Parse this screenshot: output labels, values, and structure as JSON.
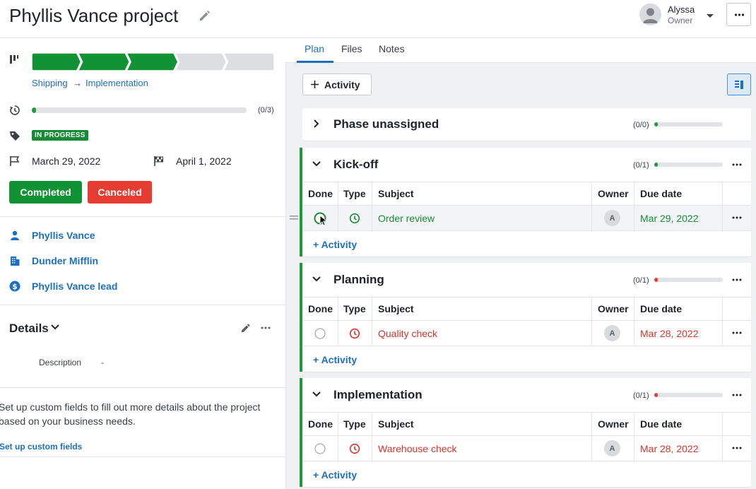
{
  "header": {
    "title": "Phyllis Vance project",
    "user_name": "Alyssa",
    "user_role": "Owner"
  },
  "left": {
    "pipeline": {
      "stages_total": 5,
      "stages_done": 3
    },
    "breadcrumb": {
      "from": "Shipping",
      "arrow": "→",
      "to": "Implementation"
    },
    "progress": {
      "count": "(0/3)",
      "fraction": 0.02
    },
    "status": "IN PROGRESS",
    "start_date": "March 29, 2022",
    "end_date": "April 1, 2022",
    "completed_label": "Completed",
    "canceled_label": "Canceled",
    "links": {
      "person": "Phyllis Vance",
      "org": "Dunder Mifflin",
      "lead": "Phyllis Vance lead"
    },
    "details": {
      "title": "Details",
      "description_label": "Description",
      "description_value": "-",
      "custom_text": "Set up custom fields to fill out more details about the project based on your business needs.",
      "custom_link": "Set up custom fields"
    }
  },
  "tabs": [
    "Plan",
    "Files",
    "Notes"
  ],
  "add_activity_label": "Activity",
  "columns": {
    "done": "Done",
    "type": "Type",
    "subject": "Subject",
    "owner": "Owner",
    "due": "Due date"
  },
  "phases": [
    {
      "title": "Phase unassigned",
      "count": "(0/0)",
      "fill_color": "#1a9c3e"
    },
    {
      "title": "Kick-off",
      "count": "(0/1)",
      "fill_color": "#1a9c3e",
      "activity": {
        "subject": "Order review",
        "owner": "A",
        "due": "Mar 29, 2022",
        "status": "green"
      },
      "add_label": "Activity"
    },
    {
      "title": "Planning",
      "count": "(0/1)",
      "fill_color": "#e53d32",
      "activity": {
        "subject": "Quality check",
        "owner": "A",
        "due": "Mar 28, 2022",
        "status": "red"
      },
      "add_label": "Activity"
    },
    {
      "title": "Implementation",
      "count": "(0/1)",
      "fill_color": "#e53d32",
      "activity": {
        "subject": "Warehouse check",
        "owner": "A",
        "due": "Mar 28, 2022",
        "status": "red"
      },
      "add_label": "Activity"
    }
  ],
  "colors": {
    "accent": "#1d6fc2",
    "success": "#119234",
    "danger": "#e53d32"
  }
}
